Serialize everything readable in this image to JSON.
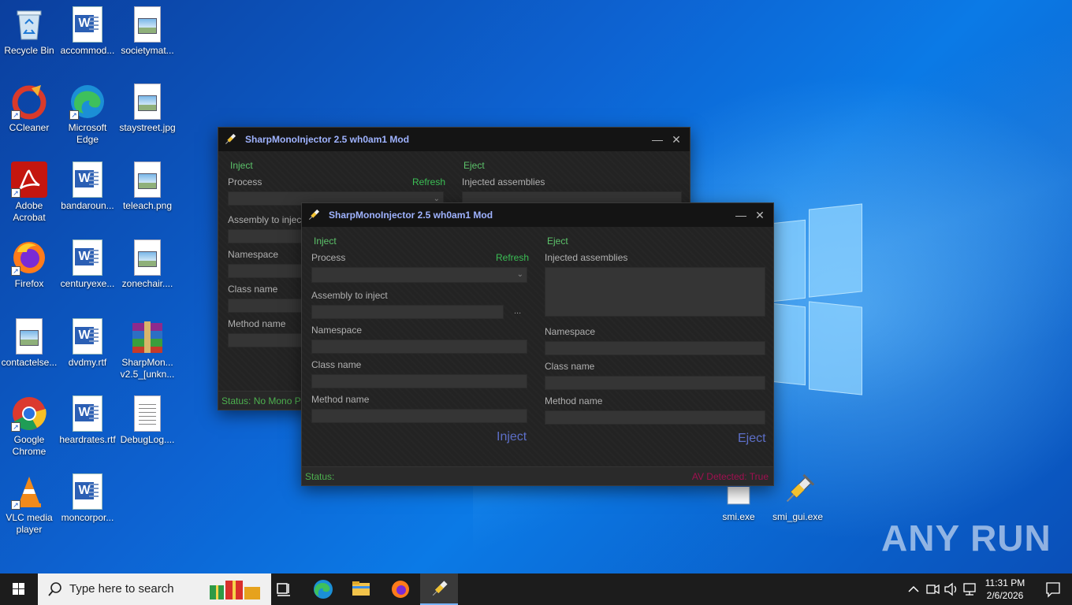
{
  "desktop": {
    "icons": [
      {
        "label": "Recycle Bin",
        "icon": "recycle-bin-icon"
      },
      {
        "label": "accommod...",
        "icon": "word-document-icon"
      },
      {
        "label": "societymat...",
        "icon": "image-file-icon"
      },
      {
        "label": "CCleaner",
        "icon": "ccleaner-icon"
      },
      {
        "label": "Microsoft Edge",
        "icon": "edge-icon"
      },
      {
        "label": "staystreet.jpg",
        "icon": "image-file-icon"
      },
      {
        "label": "Adobe Acrobat",
        "icon": "acrobat-icon"
      },
      {
        "label": "bandaroun...",
        "icon": "word-document-icon"
      },
      {
        "label": "teleach.png",
        "icon": "image-file-icon"
      },
      {
        "label": "Firefox",
        "icon": "firefox-icon"
      },
      {
        "label": "centuryexe...",
        "icon": "word-document-icon"
      },
      {
        "label": "zonechair....",
        "icon": "image-file-icon"
      },
      {
        "label": "contactelse...",
        "icon": "image-file-icon"
      },
      {
        "label": "dvdmy.rtf",
        "icon": "word-document-icon"
      },
      {
        "label": "SharpMon... v2.5_[unkn...",
        "icon": "winrar-archive-icon"
      },
      {
        "label": "Google Chrome",
        "icon": "chrome-icon"
      },
      {
        "label": "heardrates.rtf",
        "icon": "word-document-icon"
      },
      {
        "label": "DebugLog....",
        "icon": "text-file-icon"
      },
      {
        "label": "VLC media player",
        "icon": "vlc-icon"
      },
      {
        "label": "moncorpor...",
        "icon": "word-document-icon"
      },
      {
        "label": "smi.exe",
        "icon": "exe-file-icon"
      },
      {
        "label": "smi_gui.exe",
        "icon": "syringe-icon"
      }
    ],
    "watermark": "ANY RUN"
  },
  "window_back": {
    "title": "SharpMonoInjector 2.5 wh0am1 Mod",
    "inject_group": "Inject",
    "eject_group": "Eject",
    "process_label": "Process",
    "refresh_label": "Refresh",
    "injected_assemblies_label": "Injected assemblies",
    "assembly_label": "Assembly to inject",
    "namespace_label": "Namespace",
    "class_label": "Class name",
    "method_label": "Method name",
    "status": "Status:  No Mono P"
  },
  "window_front": {
    "title": "SharpMonoInjector 2.5 wh0am1 Mod",
    "inject_group": "Inject",
    "eject_group": "Eject",
    "process_label": "Process",
    "refresh_label": "Refresh",
    "assembly_label": "Assembly to inject",
    "browse_label": "...",
    "namespace_label": "Namespace",
    "class_label": "Class name",
    "method_label": "Method name",
    "inject_button": "Inject",
    "injected_assemblies_label": "Injected assemblies",
    "eject_namespace_label": "Namespace",
    "eject_class_label": "Class name",
    "eject_method_label": "Method name",
    "eject_button": "Eject",
    "status": "Status:",
    "av_status": "AV Detected:  True"
  },
  "taskbar": {
    "search_placeholder": "Type here to search",
    "time": "11:31 PM",
    "date": "2/6/2026"
  }
}
